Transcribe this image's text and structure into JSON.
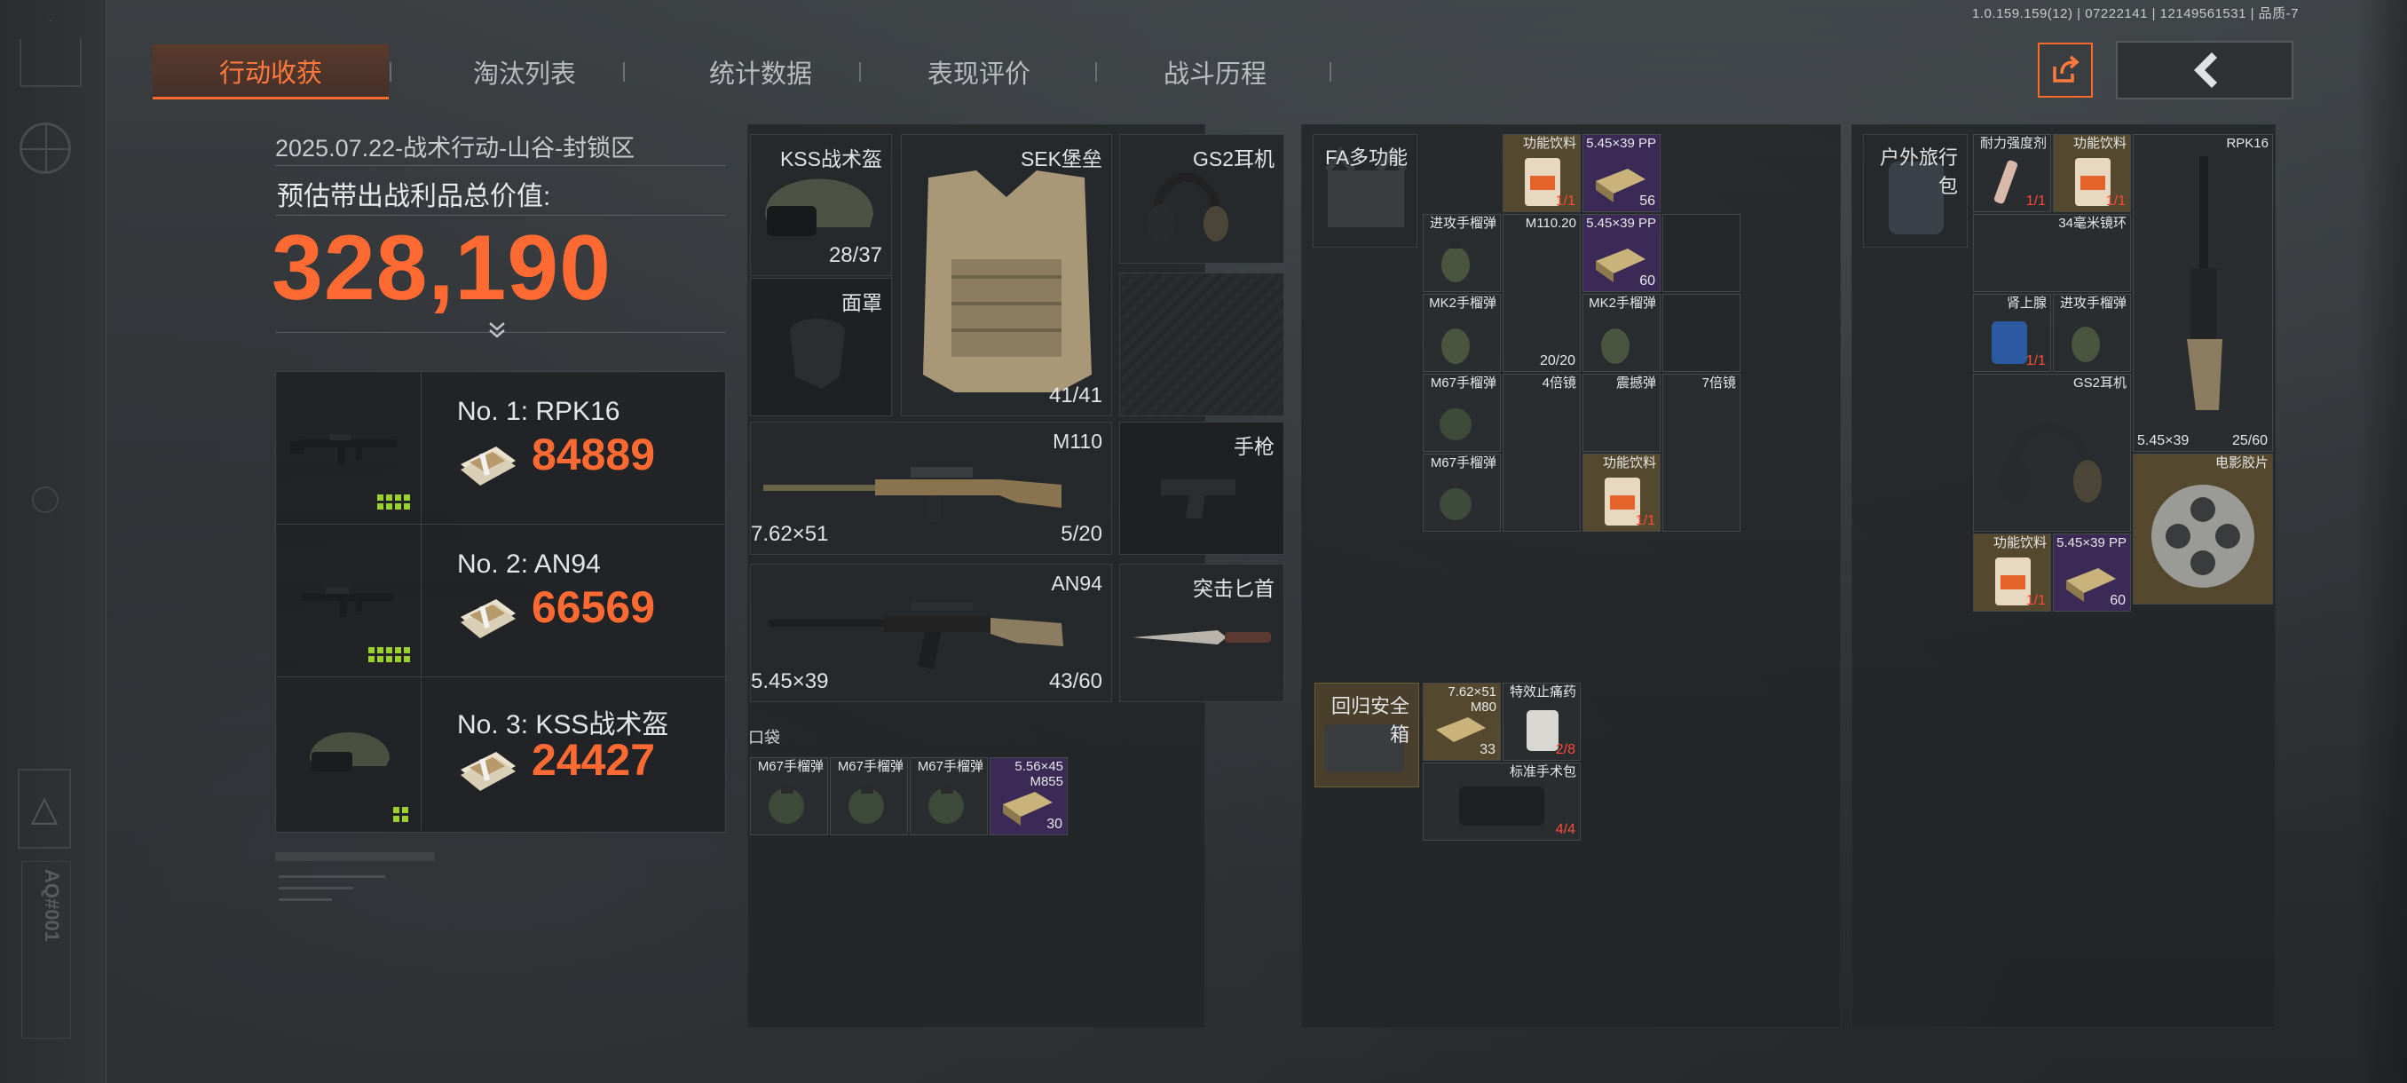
{
  "version": "1.0.159.159(12) | 07222141 | 12149561531 | 品质-7",
  "tabs": [
    "行动收获",
    "淘汰列表",
    "统计数据",
    "表现评价",
    "战斗历程"
  ],
  "summary": {
    "date_line": "2025.07.22-战术行动-山谷-封锁区",
    "value_title": "预估带出战利品总价值:",
    "total_value": "328,190"
  },
  "top_items": [
    {
      "name": "No. 1: RPK16",
      "value": "84889"
    },
    {
      "name": "No. 2: AN94",
      "value": "66569"
    },
    {
      "name": "No. 3: KSS战术盔",
      "value": "24427"
    }
  ],
  "equipment": {
    "helmet": {
      "name": "KSS战术盔",
      "count": "28/37"
    },
    "armor": {
      "name": "SEK堡垒",
      "count": "41/41"
    },
    "headset": {
      "name": "GS2耳机"
    },
    "mask": {
      "name": "面罩"
    },
    "primary": {
      "name": "M110",
      "caliber": "7.62×51",
      "count": "5/20"
    },
    "pistol": {
      "name": "手枪"
    },
    "secondary": {
      "name": "AN94",
      "caliber": "5.45×39",
      "count": "43/60"
    },
    "melee": {
      "name": "突击匕首"
    },
    "pocket_label": "口袋",
    "pockets": [
      {
        "name": "M67手榴弹",
        "count": ""
      },
      {
        "name": "M67手榴弹",
        "count": ""
      },
      {
        "name": "M67手榴弹",
        "count": ""
      },
      {
        "name": "5.56×45 M855",
        "count": "30"
      }
    ]
  },
  "rig": {
    "name": "FA多功能",
    "items": [
      {
        "name": "功能饮料",
        "count": "1/1"
      },
      {
        "name": "5.45×39 PP",
        "count": "56"
      },
      {
        "name": "进攻手榴弹",
        "count": ""
      },
      {
        "name": "M110.20",
        "count": "20/20"
      },
      {
        "name": "5.45×39 PP",
        "count": "60"
      },
      {
        "name": "MK2手榴弹",
        "count": ""
      },
      {
        "name": "MK2手榴弹",
        "count": ""
      },
      {
        "name": "M67手榴弹",
        "count": ""
      },
      {
        "name": "4倍镜",
        "count": ""
      },
      {
        "name": "震撼弹",
        "count": ""
      },
      {
        "name": "7倍镜",
        "count": ""
      },
      {
        "name": "M67手榴弹",
        "count": ""
      },
      {
        "name": "功能饮料",
        "count": "1/1"
      }
    ]
  },
  "safebox": {
    "name": "回归安全箱",
    "items": [
      {
        "name": "7.62×51 M80",
        "count": "33"
      },
      {
        "name": "特效止痛药",
        "count": "2/8"
      },
      {
        "name": "标准手术包",
        "count": "4/4"
      }
    ]
  },
  "backpack": {
    "name": "户外旅行包",
    "items": [
      {
        "name": "耐力强度剂",
        "count": "1/1"
      },
      {
        "name": "功能饮料",
        "count": "1/1"
      },
      {
        "name": "RPK16",
        "caliber": "5.45×39",
        "count": "25/60"
      },
      {
        "name": "34毫米镜环",
        "count": ""
      },
      {
        "name": "肾上腺",
        "count": "1/1"
      },
      {
        "name": "进攻手榴弹",
        "count": ""
      },
      {
        "name": "GS2耳机",
        "count": ""
      },
      {
        "name": "电影胶片",
        "count": ""
      },
      {
        "name": "功能饮料",
        "count": "1/1"
      },
      {
        "name": "5.45×39 PP",
        "count": "60"
      }
    ]
  },
  "colors": {
    "accent": "#ff6a32",
    "rare_purple": "#3a2a55",
    "gold": "#54482e"
  }
}
